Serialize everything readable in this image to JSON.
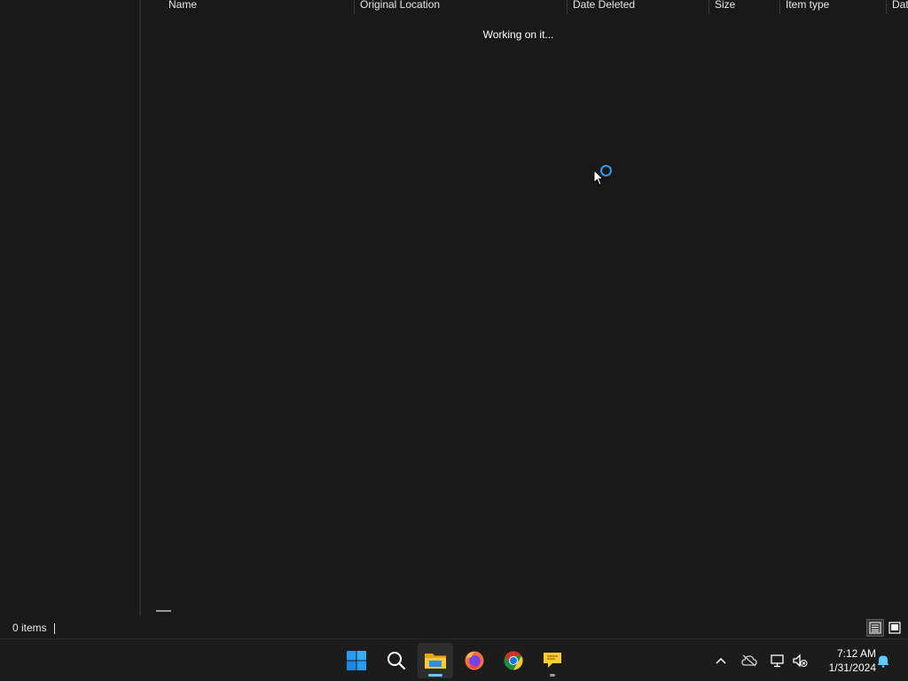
{
  "columns": [
    {
      "label": "Name"
    },
    {
      "label": "Original Location"
    },
    {
      "label": "Date Deleted"
    },
    {
      "label": "Size"
    },
    {
      "label": "Item type"
    },
    {
      "label": "Dat"
    }
  ],
  "content": {
    "loading_text": "Working on it..."
  },
  "status_bar": {
    "item_count": "0 items",
    "views": [
      "details-view-icon",
      "large-icons-view-icon"
    ],
    "active_view": "details"
  },
  "taskbar": {
    "apps": [
      {
        "name": "start-button",
        "icon": "windows-logo-icon"
      },
      {
        "name": "search-button",
        "icon": "search-icon"
      },
      {
        "name": "file-explorer",
        "icon": "folder-icon",
        "active": true
      },
      {
        "name": "firefox",
        "icon": "firefox-icon"
      },
      {
        "name": "chrome",
        "icon": "chrome-icon"
      },
      {
        "name": "sticky-notes",
        "icon": "speech-bubble-icon",
        "running": true
      }
    ],
    "tray": [
      "chevron-up-icon",
      "cloud-off-icon",
      "network-icon",
      "volume-muted-icon",
      "notification-bell-icon"
    ],
    "time": "7:12 AM",
    "date": "1/31/2024"
  },
  "colors": {
    "background": "#191919",
    "accent": "#60cdff",
    "spinner": "#2d9cf0"
  }
}
